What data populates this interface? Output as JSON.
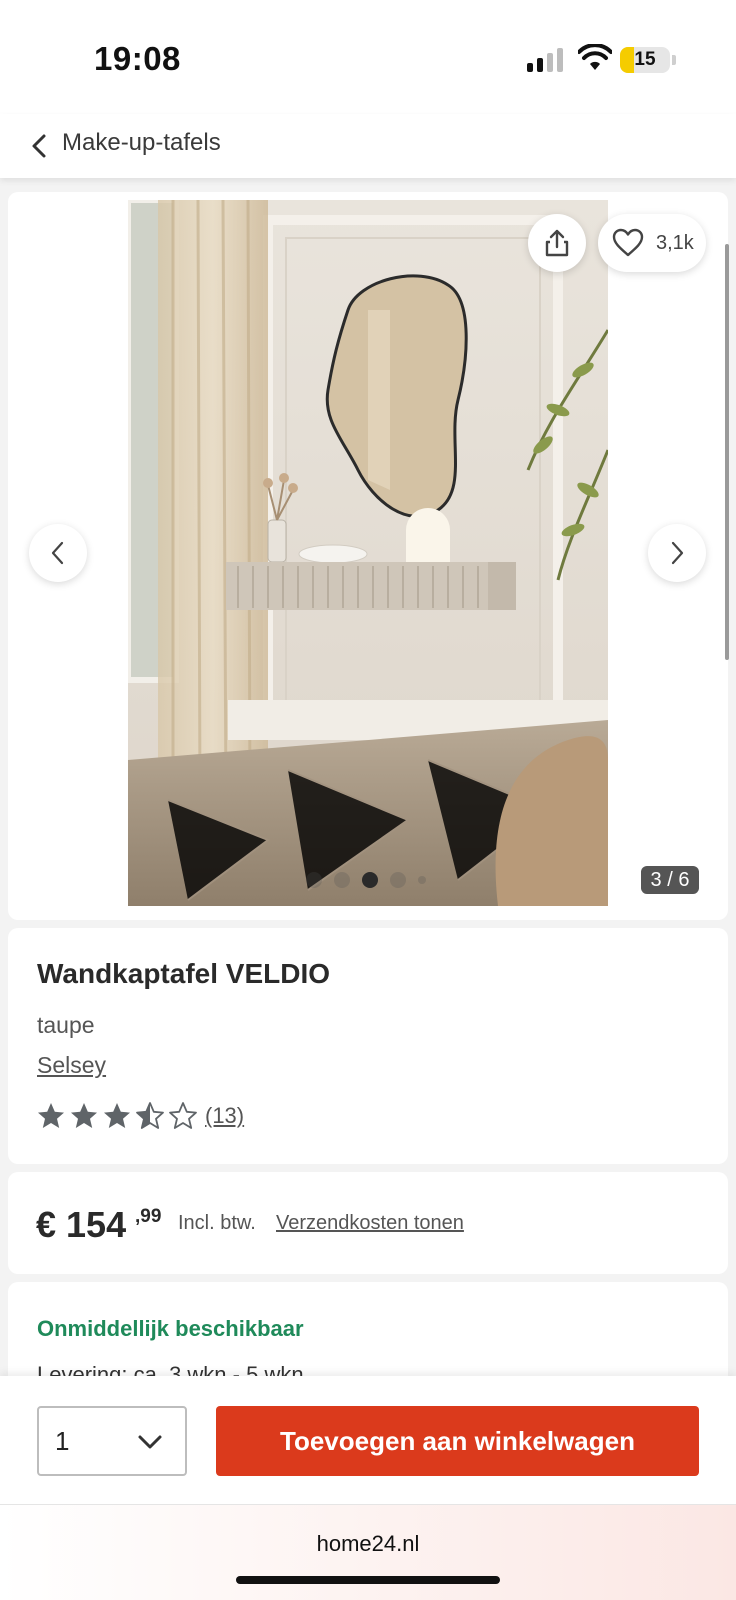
{
  "status_bar": {
    "time": "19:08",
    "battery": "15"
  },
  "nav": {
    "back_label": "Make-up-tafels"
  },
  "gallery": {
    "favorite_count": "3,1k",
    "counter": "3 / 6",
    "current_image": 3,
    "total_images": 6
  },
  "product": {
    "title": "Wandkaptafel VELDIO",
    "color": "taupe",
    "brand": "Selsey",
    "rating": 3.5,
    "rating_count": "(13)"
  },
  "price": {
    "main": "€ 154",
    "cents": ",99",
    "vat": "Incl. btw.",
    "shipping_link": "Verzendkosten tonen"
  },
  "availability": {
    "status": "Onmiddellijk beschikbaar",
    "delivery": "Levering: ca. 3 wkn - 5 wkn"
  },
  "cart": {
    "quantity": "1",
    "add_button": "Toevoegen aan winkelwagen"
  },
  "browser": {
    "url": "home24.nl"
  },
  "colors": {
    "accent": "#db3a1c",
    "availability": "#1f8a5a",
    "battery": "#f5cc00"
  }
}
